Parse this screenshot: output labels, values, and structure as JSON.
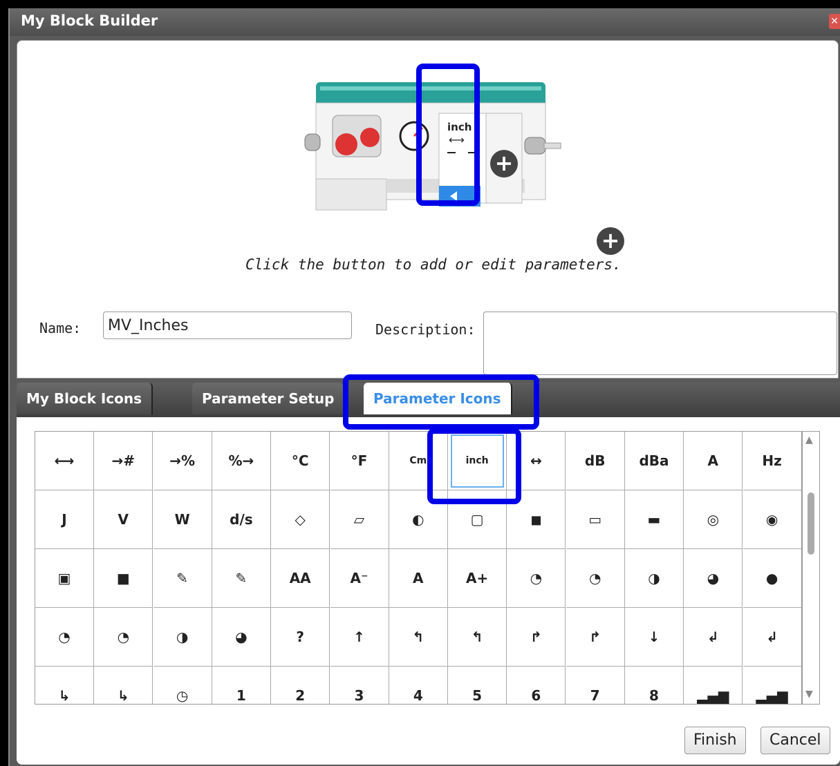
{
  "window": {
    "title": "My Block Builder",
    "close_icon": "close-icon"
  },
  "block_preview": {
    "param_label": "inch",
    "hint": "Click the button to add or edit parameters."
  },
  "form": {
    "name_label": "Name:",
    "name_value": "MV_Inches",
    "description_label": "Description:",
    "description_value": ""
  },
  "tabs": [
    {
      "label": "My Block Icons",
      "active": false
    },
    {
      "label": "Parameter Setup",
      "active": false
    },
    {
      "label": "Parameter Icons",
      "active": true
    }
  ],
  "icon_grid": {
    "rows": [
      [
        "⟷",
        "→#",
        "→%",
        "%→",
        "°C",
        "°F",
        "Cm",
        "inch",
        "↔",
        "dB",
        "dBa",
        "A",
        "Hz"
      ],
      [
        "J",
        "V",
        "W",
        "d/s",
        "◇",
        "▱",
        "◐",
        "▢",
        "◼",
        "▭",
        "▬",
        "◎",
        "◉"
      ],
      [
        "▣",
        "■",
        "✎",
        "✎",
        "AA",
        "A⁻",
        "A",
        "A+",
        "◔",
        "◔",
        "◑",
        "◕",
        "●"
      ],
      [
        "◔",
        "◔",
        "◑",
        "◕",
        "?",
        "↑",
        "↰",
        "↰",
        "↱",
        "↱",
        "↓",
        "↲",
        "↲"
      ],
      [
        "↳",
        "↳",
        "◷",
        "1",
        "2",
        "3",
        "4",
        "5",
        "6",
        "7",
        "8",
        "▂▄▆",
        "▂▄▆"
      ]
    ],
    "selected": "inch"
  },
  "buttons": {
    "finish": "Finish",
    "cancel": "Cancel"
  },
  "colors": {
    "highlight": "#0000e8",
    "active_tab_text": "#3a8ee6",
    "teal": "#2aa198"
  }
}
